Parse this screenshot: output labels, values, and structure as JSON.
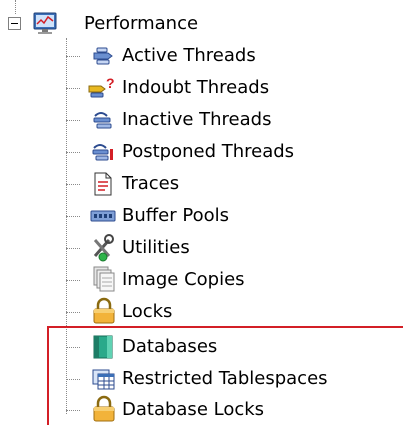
{
  "tree": {
    "root": {
      "label": "Performance",
      "icon": "monitor-chart-icon",
      "expanded": true
    },
    "items": [
      {
        "label": "Active Threads",
        "icon": "active-threads-icon"
      },
      {
        "label": "Indoubt Threads",
        "icon": "indoubt-threads-icon"
      },
      {
        "label": "Inactive Threads",
        "icon": "inactive-threads-icon"
      },
      {
        "label": "Postponed Threads",
        "icon": "postponed-threads-icon"
      },
      {
        "label": "Traces",
        "icon": "document-icon"
      },
      {
        "label": "Buffer Pools",
        "icon": "buffer-pool-icon"
      },
      {
        "label": "Utilities",
        "icon": "tools-icon"
      },
      {
        "label": "Image Copies",
        "icon": "image-copies-icon"
      },
      {
        "label": "Locks",
        "icon": "lock-icon"
      },
      {
        "label": "Databases",
        "icon": "database-icon"
      },
      {
        "label": "Restricted Tablespaces",
        "icon": "tablespace-icon"
      },
      {
        "label": "Database Locks",
        "icon": "lock-icon"
      }
    ]
  },
  "colors": {
    "highlight_border": "#d31f26",
    "tree_line": "#8a8a8a"
  }
}
